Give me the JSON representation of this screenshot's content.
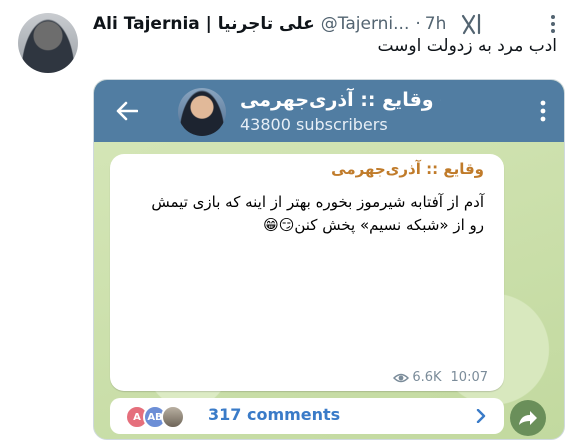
{
  "tweet": {
    "author_name": "Ali Tajernia | علی تاجرنیا",
    "handle": "@Tajerni...",
    "separator": "·",
    "time": "7h",
    "text": "ادب مرد به زدولت اوست"
  },
  "telegram": {
    "channel_name": "وقایع :: آذری‌جهرمی",
    "subscribers": "43800 subscribers",
    "message": {
      "sender": "وقایع :: آذری‌جهرمی",
      "text": "آدم از آفتابه شیرموز بخوره بهتر از اینه که بازی تیمش رو از «شبکه نسیم» پخش کنن😏😁",
      "views": "6.6K",
      "time": "10:07"
    },
    "comments": {
      "label": "317 comments",
      "avatars": [
        "A",
        "AB",
        ""
      ]
    }
  },
  "icons": {
    "grok": "grok-icon",
    "more": "more-icon",
    "back": "back-arrow-icon",
    "verified": "verified-icon",
    "eye": "eye-icon",
    "share": "share-icon"
  },
  "colors": {
    "telegram_header": "#517da2",
    "sender_name": "#c07b2a",
    "comments_link": "#3a7bc8"
  }
}
